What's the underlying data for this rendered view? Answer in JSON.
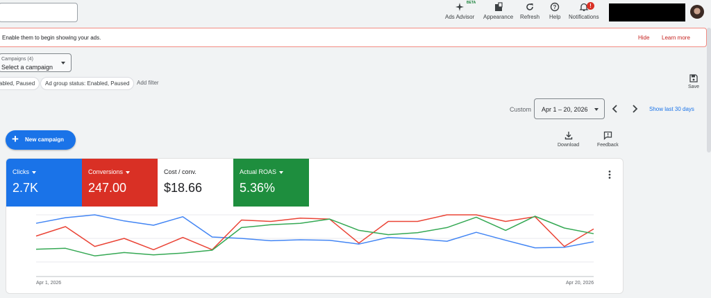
{
  "header": {
    "tools": [
      {
        "label": "Ads Advisor",
        "badge": "BETA",
        "icon": "sparkle-icon"
      },
      {
        "label": "Appearance",
        "icon": "appearance-icon"
      },
      {
        "label": "Refresh",
        "icon": "refresh-icon"
      },
      {
        "label": "Help",
        "icon": "help-icon"
      },
      {
        "label": "Notifications",
        "icon": "bell-icon",
        "badge": "!"
      }
    ]
  },
  "notice": {
    "text": "Enable them to begin showing your ads.",
    "hide": "Hide",
    "learn_more": "Learn more"
  },
  "campaign_select": {
    "label": "Campaigns (4)",
    "value": "Select a campaign"
  },
  "filters": {
    "chip1": "abled, Paused",
    "chip2": "Ad group status: Enabled, Paused",
    "add": "Add filter",
    "save": "Save"
  },
  "date": {
    "label": "Custom",
    "range": "Apr 1 – 20, 2026",
    "show_last": "Show last 30 days"
  },
  "actions": {
    "new_campaign": "New campaign",
    "download": "Download",
    "feedback": "Feedback"
  },
  "metrics": [
    {
      "label": "Clicks",
      "value": "2.7K",
      "color": "#1a73e8",
      "dropdown": true
    },
    {
      "label": "Conversions",
      "value": "247.00",
      "color": "#d93025",
      "dropdown": true
    },
    {
      "label": "Cost / conv.",
      "value": "$18.66",
      "color": "#ffffff",
      "dropdown": false
    },
    {
      "label": "Actual ROAS",
      "value": "5.36%",
      "color": "#1e8e3e",
      "dropdown": true
    }
  ],
  "chart_data": {
    "type": "line",
    "x_start_label": "Apr 1, 2026",
    "x_end_label": "Apr 20, 2026",
    "grid": true,
    "series": [
      {
        "name": "Clicks",
        "color": "#4285f4",
        "values": [
          0.82,
          0.94,
          1.0,
          0.87,
          0.78,
          0.96,
          0.53,
          0.5,
          0.45,
          0.47,
          0.46,
          0.38,
          0.52,
          0.49,
          0.44,
          0.63,
          0.46,
          0.3,
          0.31,
          0.43
        ]
      },
      {
        "name": "Conversions",
        "color": "#ea4335",
        "values": [
          0.55,
          0.75,
          0.33,
          0.5,
          0.26,
          0.52,
          0.26,
          0.89,
          0.86,
          0.93,
          0.91,
          0.4,
          0.86,
          0.86,
          1.0,
          1.0,
          0.86,
          0.96,
          0.33,
          0.7
        ]
      },
      {
        "name": "Actual ROAS",
        "color": "#34a853",
        "values": [
          0.27,
          0.29,
          0.13,
          0.2,
          0.15,
          0.19,
          0.25,
          0.73,
          0.79,
          0.82,
          0.91,
          0.67,
          0.58,
          0.62,
          0.73,
          0.95,
          0.67,
          0.97,
          0.72,
          0.6
        ]
      }
    ]
  }
}
